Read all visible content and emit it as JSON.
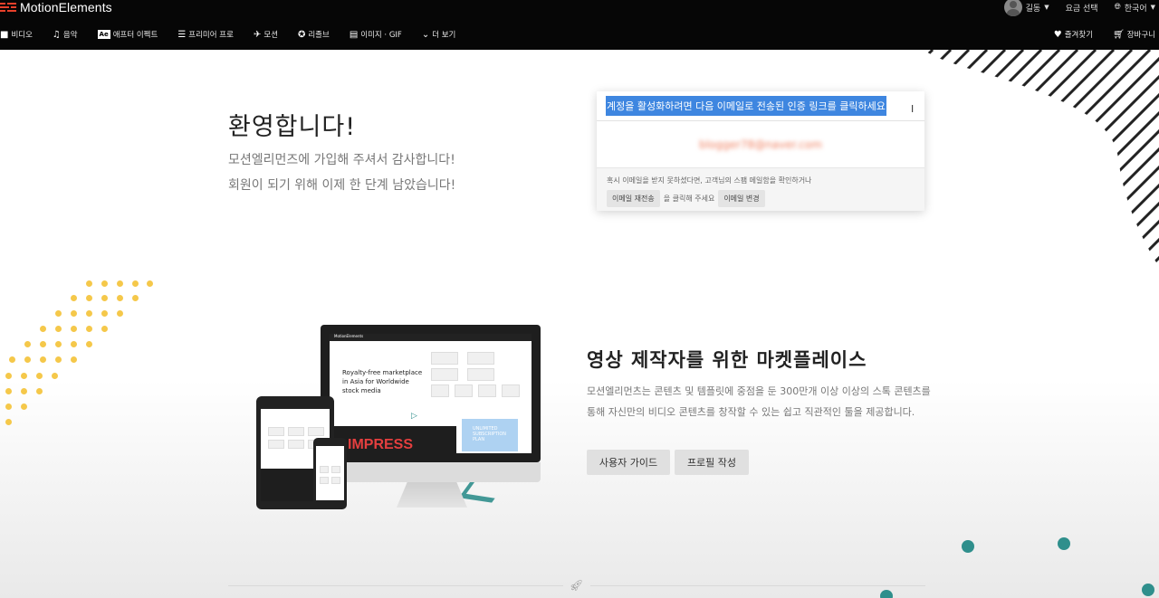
{
  "header": {
    "logo_text": "MotionElements",
    "user_name": "길동",
    "pricing_label": "요금 선택",
    "language_label": "한국어"
  },
  "nav": {
    "items": [
      {
        "label": "비디오",
        "icon": "video-camera-icon"
      },
      {
        "label": "음악",
        "icon": "music-note-icon"
      },
      {
        "label": "애프터 이펙트",
        "icon": "after-effects-icon",
        "badge": "Ae"
      },
      {
        "label": "프리미어 프로",
        "icon": "sliders-icon"
      },
      {
        "label": "모션",
        "icon": "motion-icon"
      },
      {
        "label": "리졸브",
        "icon": "resolve-icon"
      },
      {
        "label": "이미지 · GIF",
        "icon": "image-file-icon"
      },
      {
        "label": "더 보기",
        "icon": "chevron-circle-icon"
      }
    ],
    "favorites_label": "즐겨찾기",
    "cart_label": "장바구니"
  },
  "welcome": {
    "title": "환영합니다!",
    "line1": "모션엘리먼즈에 가입해 주셔서 감사합니다!",
    "line2": "회원이 되기 위해 이제 한 단계 남았습니다!"
  },
  "activation_card": {
    "instruction": "계정을 활성화하려면 다음 이메일로 전송된 인증 링크를 클릭하세요",
    "email": "blogger78@naver.com",
    "help_text": "혹시 이메일을 받지 못하셨다면, 고객님의 스팸 메일함을 확인하거나",
    "resend_button": "이메일 재전송",
    "middle_text": "을 클릭해 주세요",
    "change_button": "이메일 변경"
  },
  "marketplace": {
    "title": "영상 제작자를 위한 마켓플레이스",
    "description": "모션엘리먼츠는 콘텐츠 및 템플릿에 중점을 둔 300만개 이상 이상의 스톡 콘텐츠를 통해 자신만의 비디오 콘텐츠를 창작할 수 있는 쉽고 직관적인 툴을 제공합니다.",
    "guide_button": "사용자 가이드",
    "profile_button": "프로필 작성"
  },
  "mockup": {
    "monitor_logo": "MotionElements",
    "monitor_headline": "Royalty-free marketplace in Asia for Worldwide stock media",
    "impress_text": "IMPRESS",
    "plan_text": "UNLIMITED SUBSCRIPTION PLAN"
  },
  "colors": {
    "header_bg": "#060606",
    "selection": "#3e86e0",
    "accent_red": "#e8402a",
    "dot_yellow": "#f5c84a",
    "teal": "#2f8f8c"
  }
}
